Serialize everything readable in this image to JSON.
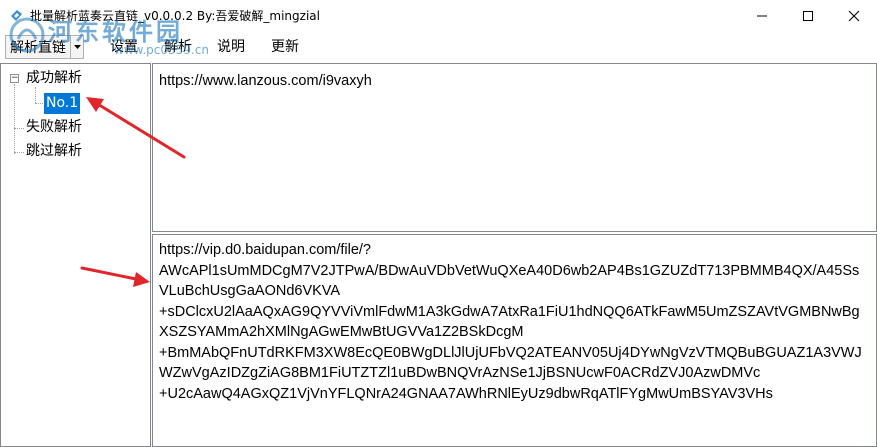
{
  "window": {
    "title": "批量解析蓝奏云直链_v0.0.0.2 By:吾爱破解_mingzial",
    "minimize_glyph": "—",
    "maximize_glyph": "☐",
    "close_glyph": "✕"
  },
  "watermark": {
    "text": "河东软件园",
    "url": "www.pc0359.cn"
  },
  "menu": {
    "split_button_label": "解析直链",
    "items": [
      {
        "label": "设置"
      },
      {
        "label": "解析"
      },
      {
        "label": "说明"
      },
      {
        "label": "更新"
      }
    ]
  },
  "tree": {
    "expander_glyph": "−",
    "nodes": {
      "success": "成功解析",
      "no1": "No.1",
      "failed": "失败解析",
      "skipped": "跳过解析"
    }
  },
  "input_text": "https://www.lanzous.com/i9vaxyh",
  "output_text": "https://vip.d0.baidupan.com/file/?\nAWcAPl1sUmMDCgM7V2JTPwA/BDwAuVDbVetWuQXeA40D6wb2AP4Bs1GZUZdT713PBMMB4QX/A45SsVLuBchUsgGaAONd6VKVA\n+sDClcxU2lAaAQxAG9QYVViVmlFdwM1A3kGdwA7AtxRa1FiU1hdNQQ6ATkFawM5UmZSZAVtVGMBNwBgXSZSYAMmA2hXMlNgAGwEMwBtUGVVa1Z2BSkDcgM\n+BmMAbQFnUTdRKFM3XW8EcQE0BWgDLlJlUjUFbVQ2ATEANV05Uj4DYwNgVzVTMQBuBGUAZ1A3VWJWZwVgAzIDZgZiAG8BM1FiUTZTZl1uBDwBNQVrAzNSe1JjBSNUcwF0ACRdZVJ0AzwDMVc\n+U2cAawQ4AGxQZ1VjVnYFLQNrA24GNAA7AWhRNlEyUz9dbwRqATlFYgMwUmBSYAV3VHs",
  "icons": {
    "app": "app-icon",
    "tree_expander": "tree-collapse-icon"
  },
  "colors": {
    "selection": "#0078d7",
    "arrow": "#e0262a",
    "watermark": "#1e78be",
    "border": "#828790"
  }
}
